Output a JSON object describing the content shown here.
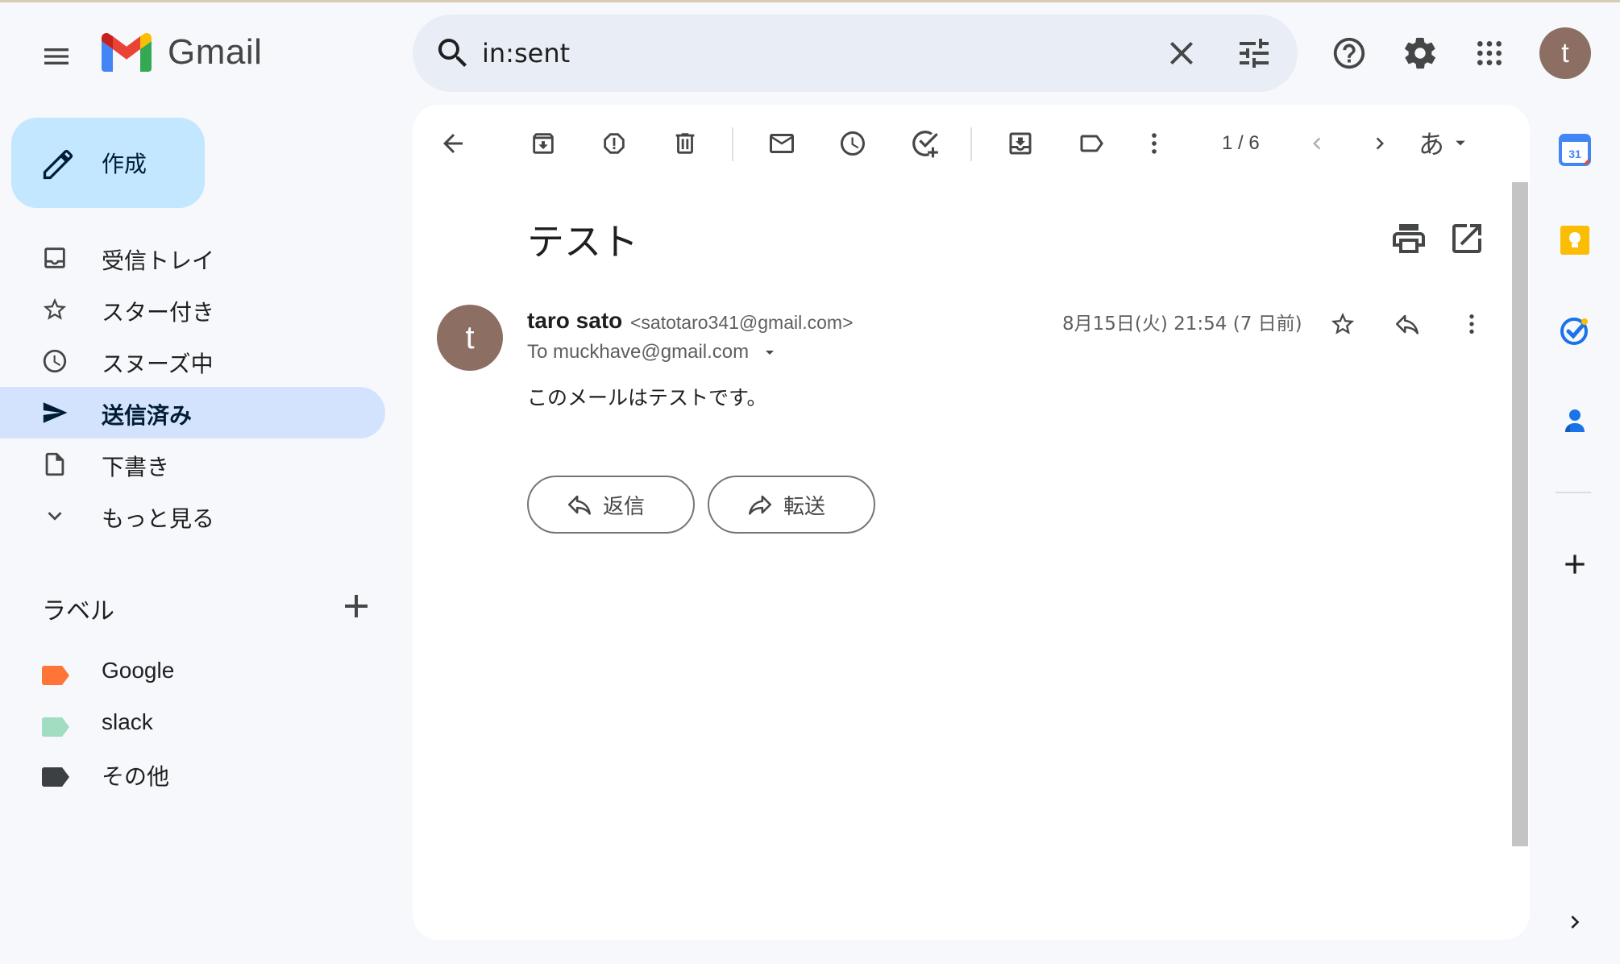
{
  "app": {
    "name": "Gmail"
  },
  "search": {
    "value": "in:sent"
  },
  "compose": {
    "label": "作成"
  },
  "nav": [
    {
      "label": "受信トレイ"
    },
    {
      "label": "スター付き"
    },
    {
      "label": "スヌーズ中"
    },
    {
      "label": "送信済み"
    },
    {
      "label": "下書き"
    },
    {
      "label": "もっと見る"
    }
  ],
  "labels": {
    "title": "ラベル",
    "items": [
      {
        "name": "Google",
        "color": "#ff7537"
      },
      {
        "name": "slack",
        "color": "#a2dcc1"
      },
      {
        "name": "その他",
        "color": "#3c4043"
      }
    ]
  },
  "user": {
    "initial": "t"
  },
  "toolbar": {
    "pager": "1 / 6",
    "input_lang": "あ"
  },
  "email": {
    "subject": "テスト",
    "sender_initial": "t",
    "sender_name": "taro sato",
    "sender_email": "<satotaro341@gmail.com>",
    "to": "To muckhave@gmail.com",
    "date": "8月15日(火) 21:54 (7 日前)",
    "body": "このメールはテストです。",
    "reply_label": "返信",
    "forward_label": "転送"
  },
  "colors": {
    "compose_bg": "#c2e7ff",
    "active_nav_bg": "#d3e3fd",
    "search_bg": "#e9eef6",
    "avatar": "#8d6e63"
  }
}
